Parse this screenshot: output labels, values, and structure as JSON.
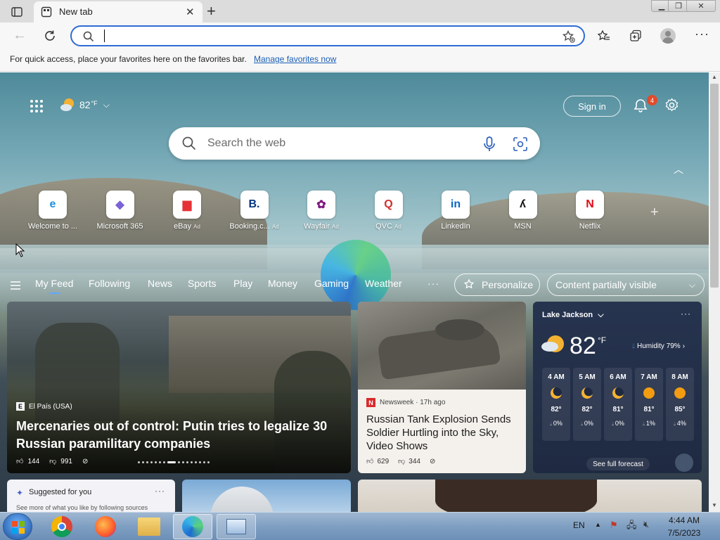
{
  "browser": {
    "tab_title": "New tab",
    "address_value": "",
    "favorites_bar_text": "For quick access, place your favorites here on the favorites bar.",
    "favorites_bar_link": "Manage favorites now"
  },
  "header": {
    "weather_temp": "82",
    "weather_unit": "°F",
    "sign_in": "Sign in",
    "notification_count": "4"
  },
  "search": {
    "placeholder": "Search the web"
  },
  "quick_links": [
    {
      "label": "Welcome to ...",
      "ad": "",
      "icon": "edge-icon"
    },
    {
      "label": "Microsoft 365",
      "ad": "",
      "icon": "m365-icon"
    },
    {
      "label": "eBay",
      "ad": "Ad",
      "icon": "ebay-icon"
    },
    {
      "label": "Booking.c...",
      "ad": "Ad",
      "icon": "booking-icon"
    },
    {
      "label": "Wayfair",
      "ad": "Ad",
      "icon": "wayfair-icon"
    },
    {
      "label": "QVC",
      "ad": "Ad",
      "icon": "qvc-icon"
    },
    {
      "label": "LinkedIn",
      "ad": "",
      "icon": "linkedin-icon"
    },
    {
      "label": "MSN",
      "ad": "",
      "icon": "msn-icon"
    },
    {
      "label": "Netflix",
      "ad": "",
      "icon": "netflix-icon"
    }
  ],
  "feed_nav": {
    "items": [
      "My Feed",
      "Following",
      "News",
      "Sports",
      "Play",
      "Money",
      "Gaming",
      "Weather"
    ],
    "more": "···",
    "personalize": "Personalize",
    "content_visibility": "Content partially visible"
  },
  "hero": {
    "source": "El País (USA)",
    "headline": "Mercenaries out of control: Putin tries to legalize 30 Russian paramilitary companies",
    "likes": "144",
    "dislikes": "991"
  },
  "tank_story": {
    "source": "Newsweek · 17h ago",
    "headline": "Russian Tank Explosion Sends Soldier Hurtling into the Sky, Video Shows",
    "likes": "629",
    "dislikes": "344"
  },
  "weather": {
    "location": "Lake Jackson",
    "temp": "82",
    "unit": "°F",
    "humidity": "Humidity 79%",
    "hours": [
      {
        "time": "4 AM",
        "temp": "82°",
        "precip": "0%",
        "icon": "moon-icon"
      },
      {
        "time": "5 AM",
        "temp": "82°",
        "precip": "0%",
        "icon": "moon-icon"
      },
      {
        "time": "6 AM",
        "temp": "81°",
        "precip": "0%",
        "icon": "moon-icon"
      },
      {
        "time": "7 AM",
        "temp": "81°",
        "precip": "1%",
        "icon": "sun-icon"
      },
      {
        "time": "8 AM",
        "temp": "85°",
        "precip": "4%",
        "icon": "sun-icon"
      }
    ],
    "forecast_link": "See full forecast"
  },
  "suggest": {
    "title": "Suggested for you",
    "body": "See more of what you like by following sources"
  },
  "taskbar": {
    "lang": "EN",
    "time": "4:44 AM",
    "date": "7/5/2023"
  }
}
